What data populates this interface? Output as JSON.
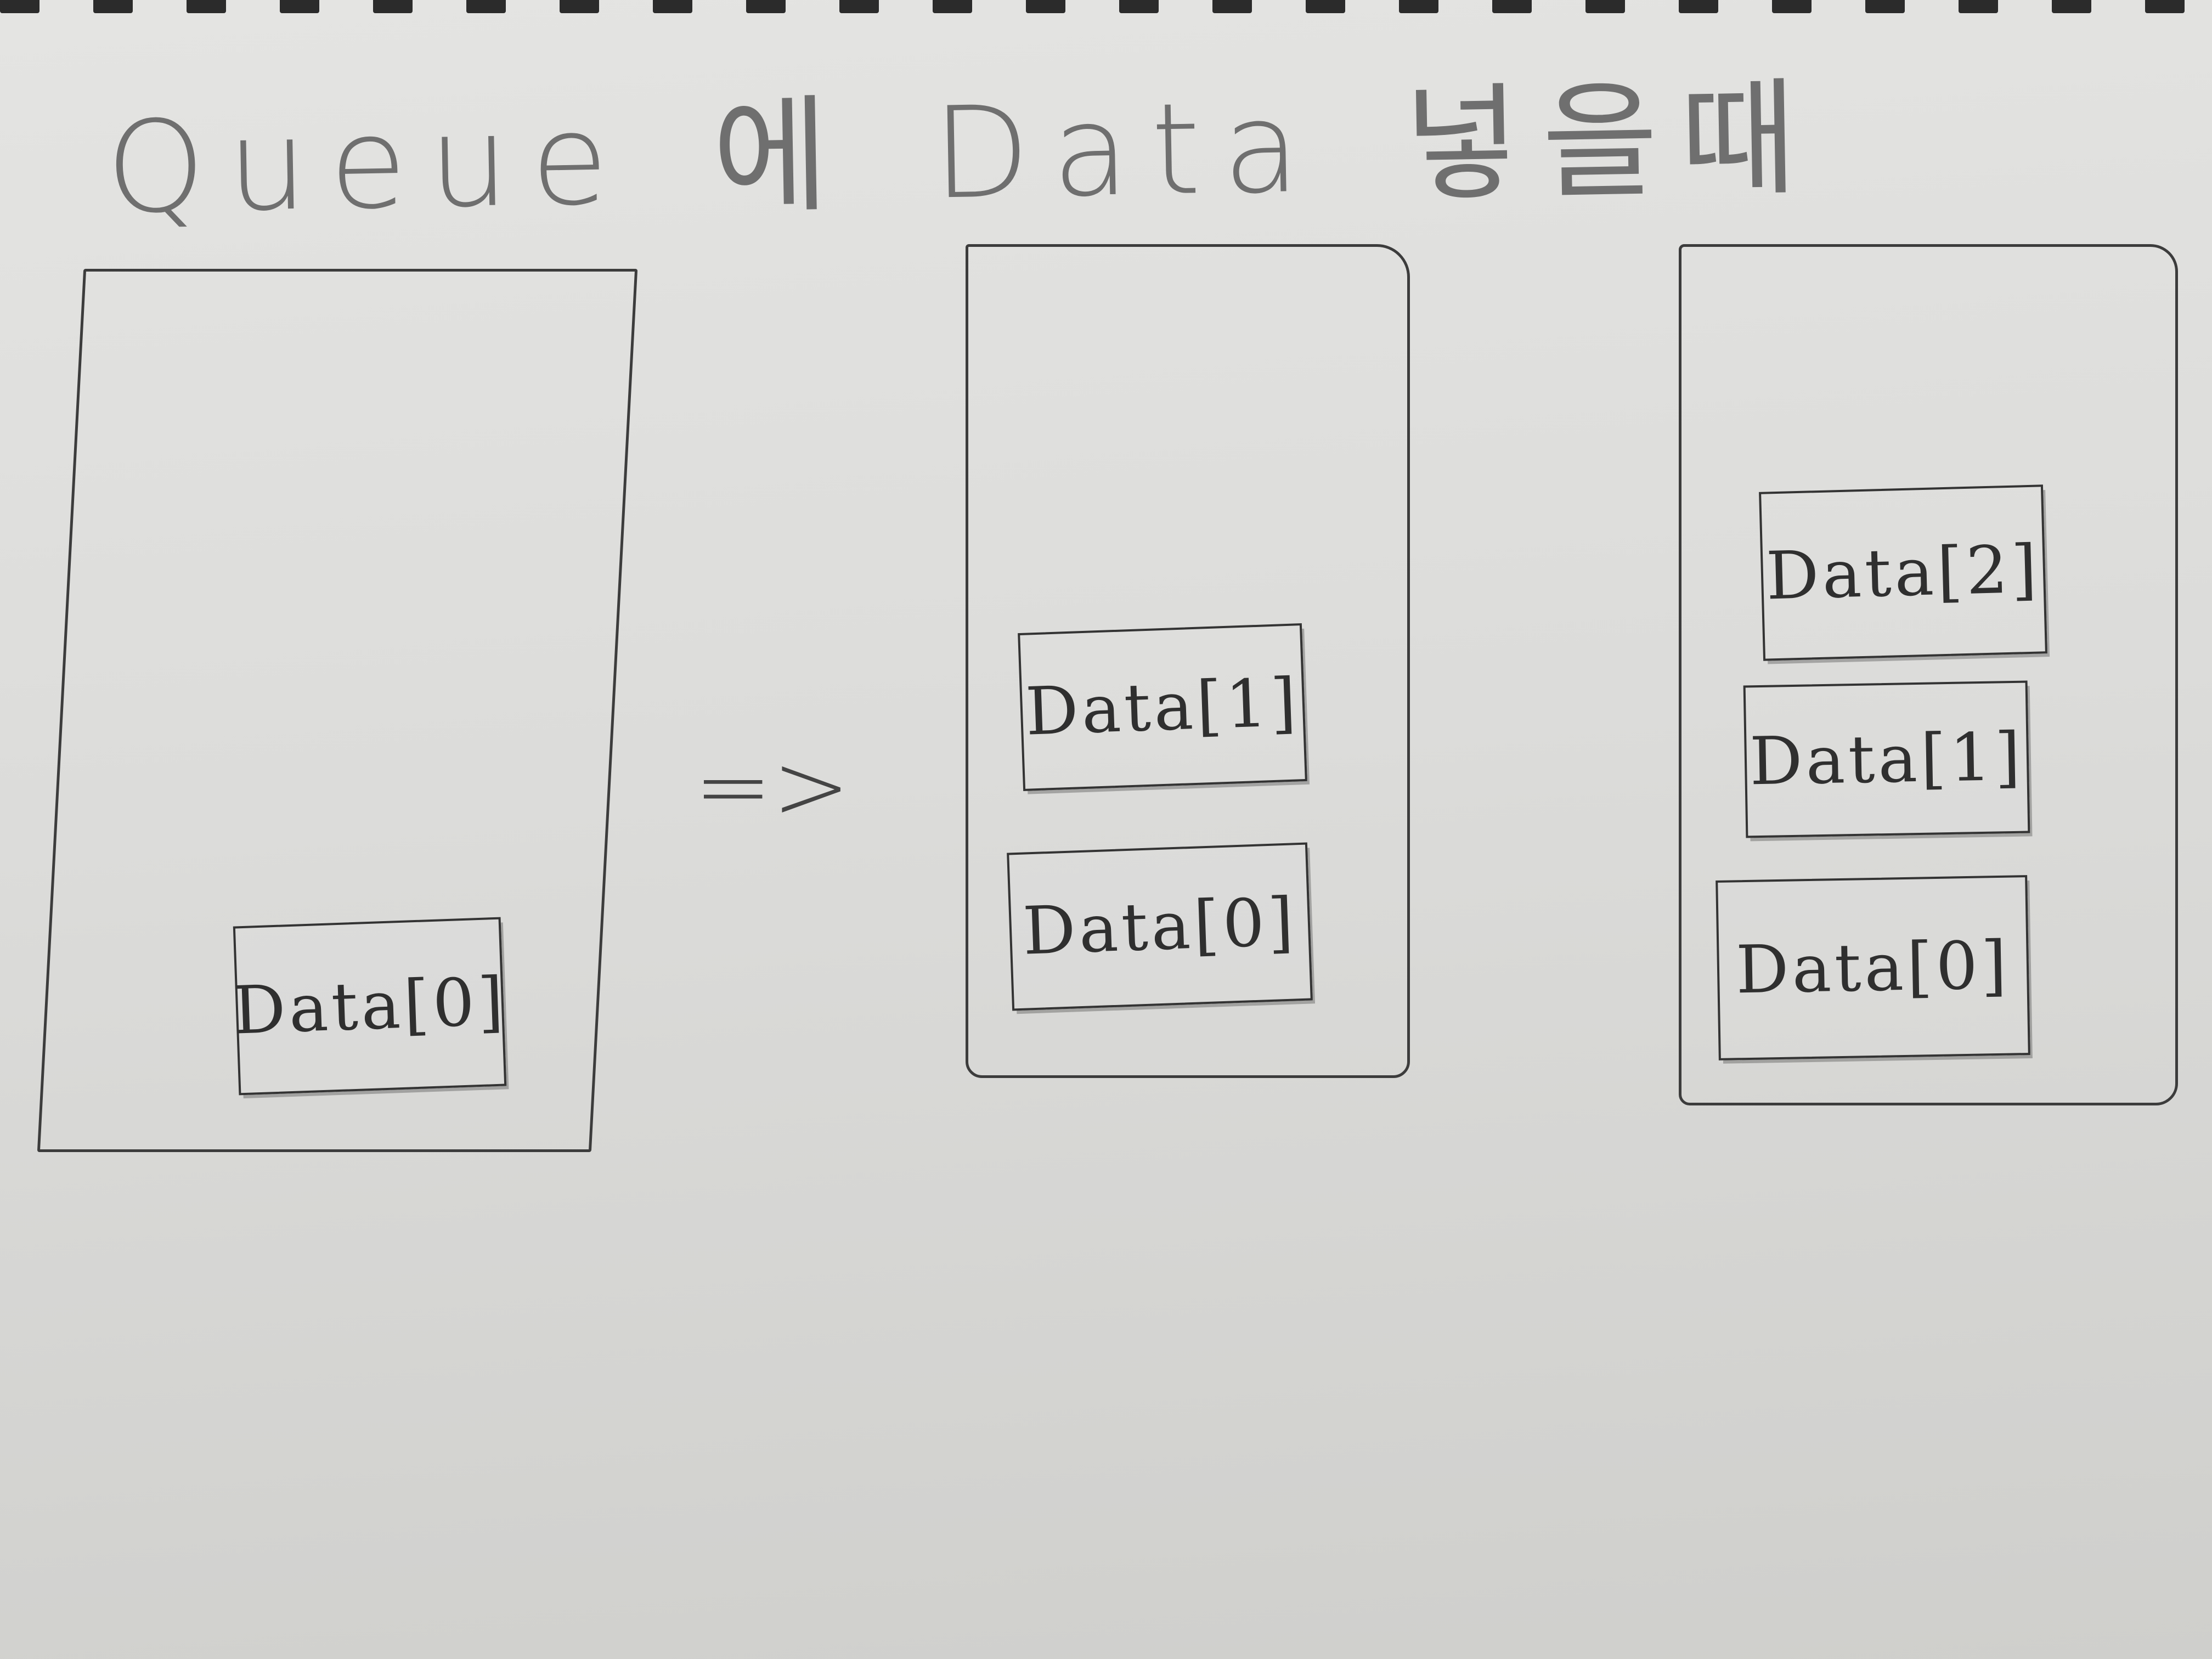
{
  "title": {
    "word1": "Queue",
    "word2": "에",
    "word3": "Data",
    "word4": "넣을때"
  },
  "arrow": "=>",
  "queues": [
    {
      "items": [
        "Data[0]"
      ]
    },
    {
      "items": [
        "Data[1]",
        "Data[0]"
      ]
    },
    {
      "items": [
        "Data[2]",
        "Data[1]",
        "Data[0]"
      ]
    }
  ],
  "colors": {
    "paper": "#dededc",
    "ink": "#333333",
    "pencil": "#6f6f6f"
  }
}
